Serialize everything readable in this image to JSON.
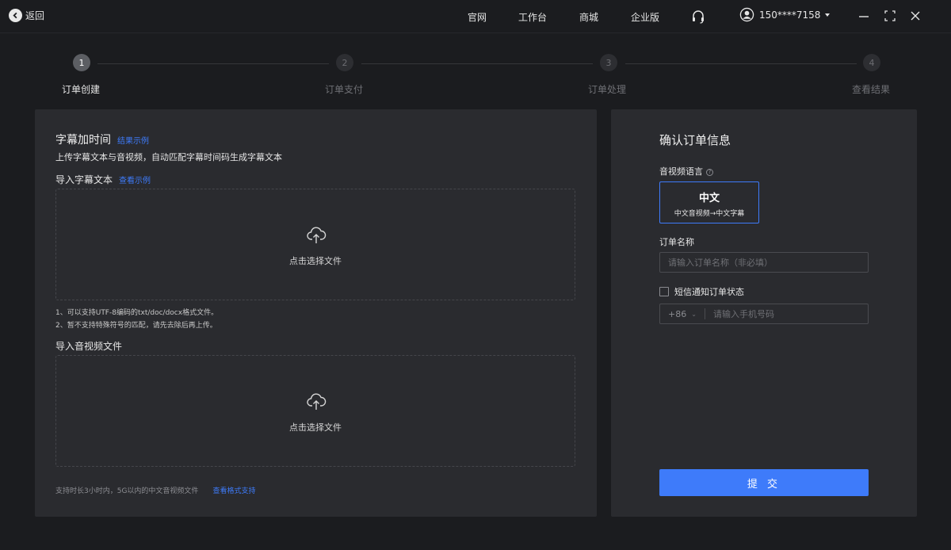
{
  "topbar": {
    "back_label": "返回",
    "nav": [
      "官网",
      "工作台",
      "商城",
      "企业版"
    ],
    "user_label": "150****7158"
  },
  "steps": [
    {
      "num": "1",
      "label": "订单创建",
      "active": true
    },
    {
      "num": "2",
      "label": "订单支付",
      "active": false
    },
    {
      "num": "3",
      "label": "订单处理",
      "active": false
    },
    {
      "num": "4",
      "label": "查看结果",
      "active": false
    }
  ],
  "left": {
    "title": "字幕加时间",
    "title_link": "结果示例",
    "desc": "上传字幕文本与音视频，自动匹配字幕时间码生成字幕文本",
    "text_section": "导入字幕文本",
    "text_section_link": "查看示例",
    "drop_label_1": "点击选择文件",
    "notes": [
      "1、可以支持UTF-8编码的txt/doc/docx格式文件。",
      "2、暂不支持特殊符号的匹配，请先去除后再上传。"
    ],
    "media_section": "导入音视频文件",
    "drop_label_2": "点击选择文件",
    "footer": "支持时长3小时内，5G以内的中文音视频文件",
    "footer_link": "查看格式支持"
  },
  "right": {
    "title": "确认订单信息",
    "lang_label": "音视频语言",
    "lang_main": "中文",
    "lang_sub": "中文音视频→中文字幕",
    "order_name_label": "订单名称",
    "order_name_placeholder": "请输入订单名称（非必填）",
    "sms_label": "短信通知订单状态",
    "country_code": "+86",
    "phone_placeholder": "请输入手机号码",
    "submit_label": "提 交"
  },
  "colors": {
    "accent": "#3e7bfa",
    "panel": "#2a2b2f",
    "background": "#1b1c1f"
  }
}
